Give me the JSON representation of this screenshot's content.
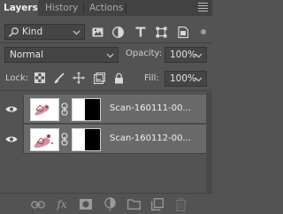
{
  "tabs": [
    {
      "label": "Layers",
      "active": true
    },
    {
      "label": "History",
      "active": false
    },
    {
      "label": "Actions",
      "active": false
    }
  ],
  "filter": {
    "kind_label": "Kind",
    "icons": [
      "image-filter-icon",
      "adjustment-filter-icon",
      "type-filter-icon",
      "shape-filter-icon",
      "smart-object-filter-icon"
    ]
  },
  "blend": {
    "mode": "Normal",
    "opacity_label": "Opacity:",
    "opacity_value": "100%"
  },
  "lock": {
    "label": "Lock:",
    "fill_label": "Fill:",
    "fill_value": "100%"
  },
  "layers": [
    {
      "name": "Scan-160111-00...",
      "visible": true
    },
    {
      "name": "Scan-160112-00...",
      "visible": true
    }
  ],
  "colors": {
    "panel_bg": "#535353",
    "tab_bar_bg": "#424242",
    "layer_row_bg": "#6a6a6a",
    "field_bg": "#454545"
  }
}
